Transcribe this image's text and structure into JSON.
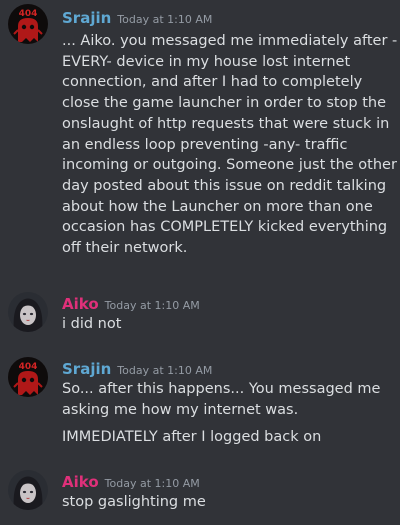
{
  "colors": {
    "background": "#313338",
    "srajin_name": "#5fa8d3",
    "aiko_name": "#e0307a",
    "text": "#dbdee1",
    "timestamp": "#949ba4"
  },
  "messages": [
    {
      "author": "Srajin",
      "avatar_icon": "red-404-ghost-avatar-icon",
      "timestamp": "Today at 1:10 AM",
      "lines": [
        "... Aiko. you messaged me immediately after -",
        "EVERY- device in my house lost internet",
        "connection, and after I had to completely",
        "close the game launcher in order to stop the",
        "onslaught of http requests that were stuck in",
        "an endless loop preventing -any- traffic",
        "incoming or outgoing. Someone just the other",
        "day posted about this issue on reddit talking",
        "about how the Launcher on more than one",
        "occasion has COMPLETELY kicked everything",
        "off their network."
      ]
    },
    {
      "author": "Aiko",
      "avatar_icon": "dark-haired-girl-avatar-icon",
      "timestamp": "Today at 1:10 AM",
      "lines": [
        "i did not"
      ]
    },
    {
      "author": "Srajin",
      "avatar_icon": "red-404-ghost-avatar-icon",
      "timestamp": "Today at 1:10 AM",
      "lines": [
        "So... after this happens... You messaged me",
        "asking me how my internet was."
      ],
      "followup": "IMMEDIATELY after I logged back on"
    },
    {
      "author": "Aiko",
      "avatar_icon": "dark-haired-girl-avatar-icon",
      "timestamp": "Today at 1:10 AM",
      "lines": [
        "stop gaslighting me"
      ]
    }
  ]
}
